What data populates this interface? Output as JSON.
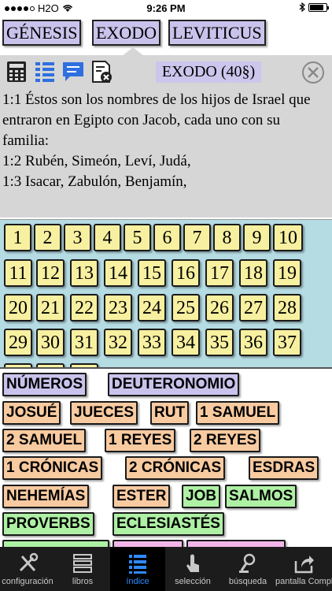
{
  "status": {
    "carrier": "H2O",
    "time": "9:26 PM"
  },
  "top_books": [
    "GÉNESIS",
    "EXODO",
    "LEVITICUS"
  ],
  "panel": {
    "title": "EXODO (40§)",
    "verses": [
      "1:1  Éstos son los nombres de los hijos de Israel que entraron en Egipto con Jacob, cada uno con su familia:",
      "1:2  Rubén, Simeón, Leví, Judá,",
      "1:3  Isacar, Zabulón, Benjamín,"
    ]
  },
  "chapters": [
    "1",
    "2",
    "3",
    "4",
    "5",
    "6",
    "7",
    "8",
    "9",
    "10",
    "11",
    "12",
    "13",
    "14",
    "15",
    "16",
    "17",
    "18",
    "19",
    "20",
    "21",
    "22",
    "23",
    "24",
    "25",
    "26",
    "27",
    "28",
    "29",
    "30",
    "31",
    "32",
    "33",
    "34",
    "35",
    "36",
    "37"
  ],
  "books": [
    {
      "label": "NÚMEROS",
      "color": "blue"
    },
    {
      "label": "DEUTERONOMIO",
      "color": "blue"
    },
    {
      "label": "JOSUÉ",
      "color": "orange"
    },
    {
      "label": "JUECES",
      "color": "orange"
    },
    {
      "label": "RUT",
      "color": "orange"
    },
    {
      "label": "1 SAMUEL",
      "color": "orange"
    },
    {
      "label": "2 SAMUEL",
      "color": "orange"
    },
    {
      "label": "1 REYES",
      "color": "orange"
    },
    {
      "label": "2 REYES",
      "color": "orange"
    },
    {
      "label": "1 CRÓNICAS",
      "color": "orange"
    },
    {
      "label": "2 CRÓNICAS",
      "color": "orange"
    },
    {
      "label": "ESDRAS",
      "color": "orange"
    },
    {
      "label": "NEHEMÍAS",
      "color": "orange"
    },
    {
      "label": "ESTER",
      "color": "orange"
    },
    {
      "label": "JOB",
      "color": "green"
    },
    {
      "label": "SALMOS",
      "color": "green"
    },
    {
      "label": "PROVERBS",
      "color": "green"
    },
    {
      "label": "ECLESIASTÉS",
      "color": "green"
    }
  ],
  "tabs": [
    {
      "label": "configuración",
      "icon": "tools-icon"
    },
    {
      "label": "libros",
      "icon": "books-icon"
    },
    {
      "label": "índice",
      "icon": "list-icon",
      "active": true
    },
    {
      "label": "selección",
      "icon": "tap-icon"
    },
    {
      "label": "búsqueda",
      "icon": "search-person-icon"
    },
    {
      "label": "pantalla Completa",
      "icon": "share-icon"
    }
  ],
  "colors": {
    "blue": "#c9c3ec",
    "orange": "#f8caa0",
    "green": "#aef0a4",
    "chapter": "#f7f0a0",
    "chapter_bg": "#b5dbe3",
    "active_tab": "#2f8bff"
  }
}
